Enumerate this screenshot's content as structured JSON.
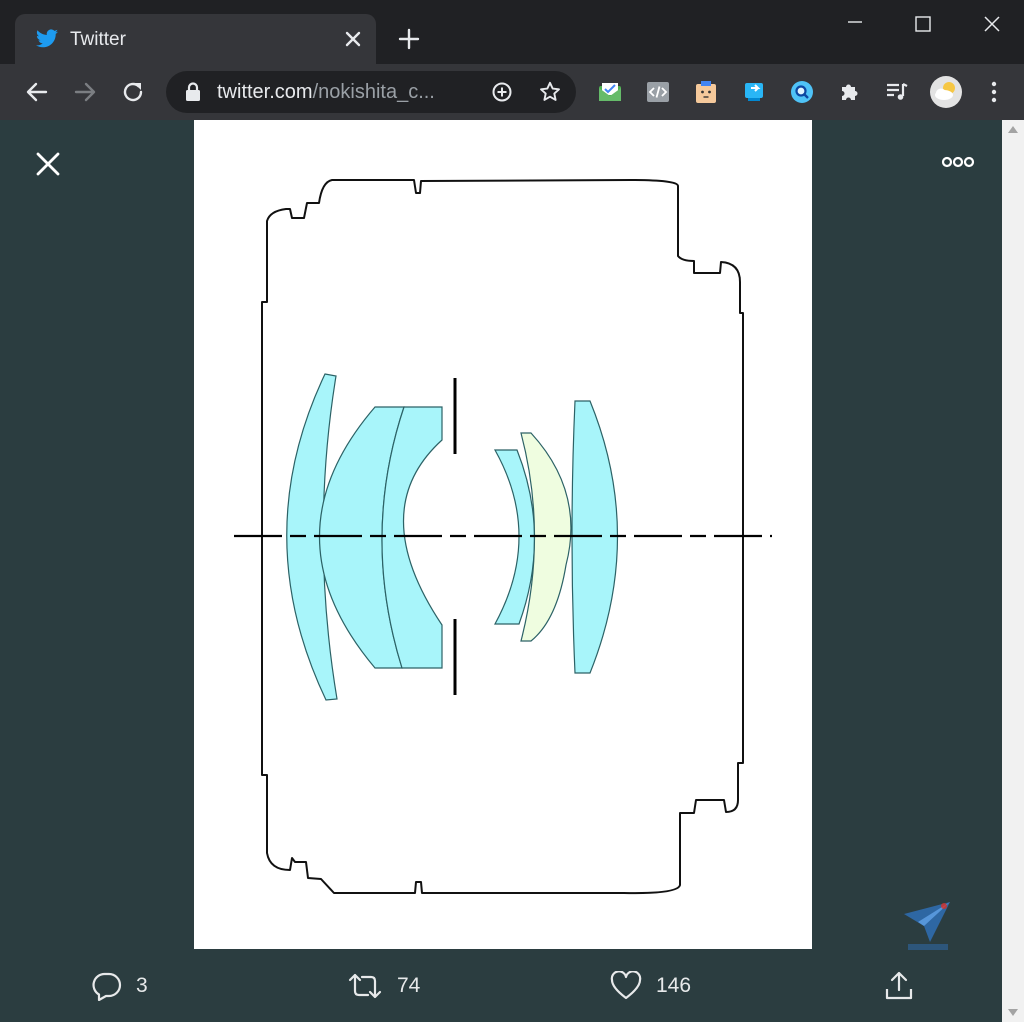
{
  "browser": {
    "tab": {
      "title": "Twitter",
      "icon": "twitter-bird-icon"
    },
    "address": {
      "host": "twitter.com",
      "path": "/nokishita_c..."
    },
    "colors": {
      "chrome_dark": "#202124",
      "chrome_light": "#35363a",
      "twitter_blue": "#1d9bf0"
    }
  },
  "viewer": {
    "background": "#2b3d40",
    "actions": {
      "replies": "3",
      "retweets": "74",
      "likes": "146"
    },
    "image": {
      "lens_colors": {
        "cyan": "#a8f5fa",
        "light_green": "#effde0"
      }
    }
  }
}
